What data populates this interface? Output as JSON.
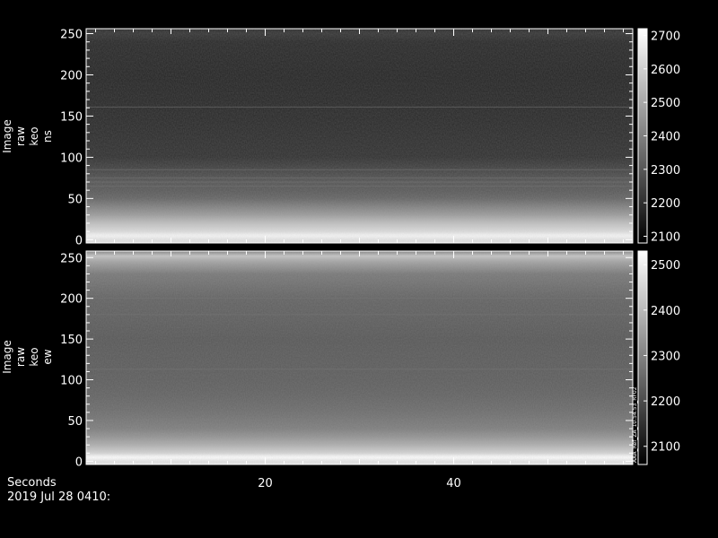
{
  "chart_data": [
    {
      "type": "heatmap",
      "ylabel_lines": [
        "Image",
        "raw",
        "keo",
        "ns"
      ],
      "x_ticks": [
        20,
        40
      ],
      "xlim": [
        1,
        59
      ],
      "y_ticks": [
        0,
        50,
        100,
        150,
        200,
        250
      ],
      "ylim": [
        -4,
        256
      ],
      "colorbar_ticks": [
        2100,
        2200,
        2300,
        2400,
        2500,
        2600,
        2700
      ],
      "colorbar_range": [
        2080,
        2720
      ],
      "profile": {
        "rows": [
          0,
          5,
          10,
          20,
          30,
          40,
          50,
          60,
          70,
          80,
          90,
          100,
          150,
          200,
          240,
          250,
          256
        ],
        "values": [
          2650,
          2700,
          2630,
          2560,
          2470,
          2400,
          2330,
          2300,
          2290,
          2260,
          2230,
          2200,
          2180,
          2170,
          2180,
          2210,
          2190
        ]
      },
      "lines": [
        161,
        85,
        75,
        70,
        65
      ]
    },
    {
      "type": "heatmap",
      "ylabel_lines": [
        "Image",
        "raw",
        "keo",
        "ew"
      ],
      "x_ticks": [
        20,
        40
      ],
      "xlim": [
        1,
        59
      ],
      "y_ticks": [
        0,
        50,
        100,
        150,
        200,
        250
      ],
      "ylim": [
        -4,
        258
      ],
      "colorbar_ticks": [
        2100,
        2200,
        2300,
        2400,
        2500
      ],
      "colorbar_range": [
        2060,
        2530
      ],
      "colorbar_note": "AAA_Ref_ZA_10.54.53_RF02",
      "profile": {
        "rows": [
          0,
          5,
          10,
          20,
          30,
          40,
          60,
          80,
          100,
          150,
          200,
          230,
          245,
          252,
          258
        ],
        "values": [
          2480,
          2530,
          2450,
          2380,
          2330,
          2290,
          2260,
          2240,
          2230,
          2220,
          2240,
          2280,
          2360,
          2420,
          2300
        ]
      },
      "lines": [
        113,
        180,
        200
      ]
    }
  ],
  "footer": {
    "axis_name": "Seconds",
    "date": "2019 Jul 28 0410:"
  }
}
